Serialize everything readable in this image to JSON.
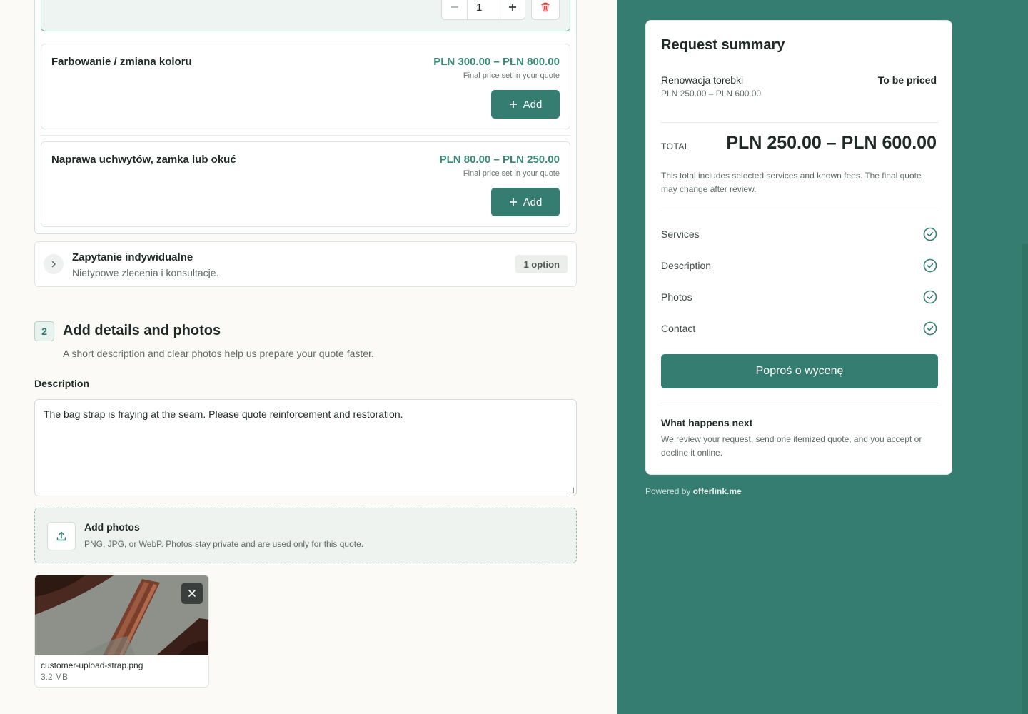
{
  "services": {
    "selected_quantity": "1",
    "items": [
      {
        "name": "Farbowanie / zmiana koloru",
        "price": "PLN 300.00 – PLN 800.00",
        "note": "Final price set in your quote",
        "add_label": "Add"
      },
      {
        "name": "Naprawa uchwytów, zamka lub okuć",
        "price": "PLN 80.00 – PLN 250.00",
        "note": "Final price set in your quote",
        "add_label": "Add"
      }
    ],
    "collapsed_category": {
      "title": "Zapytanie indywidualne",
      "subtitle": "Nietypowe zlecenia i konsultacje.",
      "badge": "1 option"
    }
  },
  "details": {
    "step_number": "2",
    "title": "Add details and photos",
    "subtitle": "A short description and clear photos help us prepare your quote faster.",
    "description_label": "Description",
    "description_value": "The bag strap is fraying at the seam. Please quote reinforcement and restoration.",
    "upload_title": "Add photos",
    "upload_hint": "PNG, JPG, or WebP. Photos stay private and are used only for this quote.",
    "photo": {
      "filename": "customer-upload-strap.png",
      "size": "3.2 MB"
    }
  },
  "summary": {
    "title": "Request summary",
    "item_name": "Renowacja torebki",
    "item_range": "PLN 250.00 – PLN 600.00",
    "item_status": "To be priced",
    "total_label": "TOTAL",
    "total_value": "PLN 250.00 – PLN 600.00",
    "total_note": "This total includes selected services and known fees. The final quote may change after review.",
    "checklist": [
      "Services",
      "Description",
      "Photos",
      "Contact"
    ],
    "cta_label": "Poproś o wycenę",
    "next_title": "What happens next",
    "next_text": "We review your request, send one itemized quote, and you accept or decline it online."
  },
  "footer": {
    "powered_prefix": "Powered by",
    "brand": "offerlink.me"
  },
  "colors": {
    "accent": "#347d70",
    "price": "#3b8a77",
    "danger": "#d23a3a",
    "panel": "#347d70"
  },
  "icons": [
    "minus-icon",
    "plus-icon",
    "trash-icon",
    "chevron-right-icon",
    "upload-icon",
    "close-icon",
    "check-circle-icon"
  ]
}
